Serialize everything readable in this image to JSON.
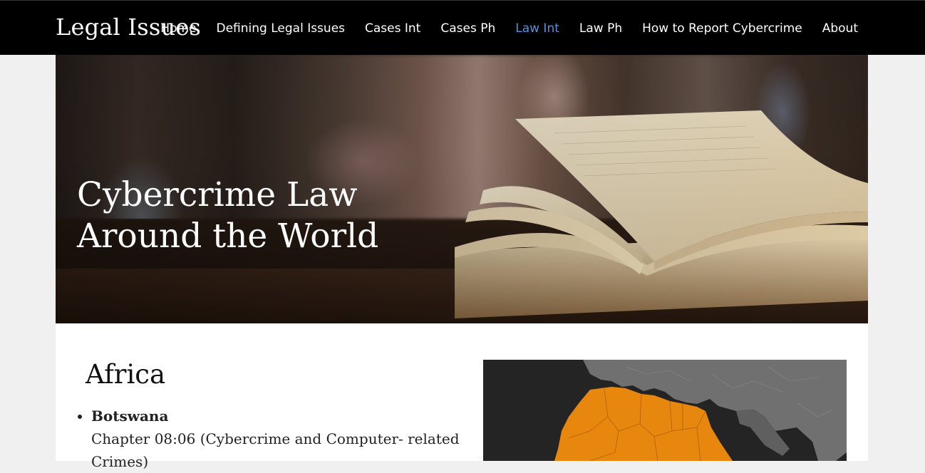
{
  "site": {
    "brand": "Legal Issues"
  },
  "nav": {
    "items": [
      {
        "label": "Home"
      },
      {
        "label": "Defining Legal Issues"
      },
      {
        "label": "Cases Int"
      },
      {
        "label": "Cases Ph"
      },
      {
        "label": "Law Int",
        "active": true
      },
      {
        "label": "Law Ph"
      },
      {
        "label": "How to Report Cybercrime"
      },
      {
        "label": "About"
      }
    ]
  },
  "hero": {
    "title_line1": "Cybercrime Law",
    "title_line2": "Around the World"
  },
  "section": {
    "title": "Africa",
    "entries": [
      {
        "country": "Botswana",
        "law": "Chapter 08:06 (Cybercrime and Computer- related Crimes)"
      }
    ]
  },
  "colors": {
    "nav_active": "#5d8fd6",
    "map_highlight": "#e8870e",
    "map_land": "#707070",
    "map_water": "#242424"
  },
  "icons": {
    "map": "africa-highlight-map"
  }
}
